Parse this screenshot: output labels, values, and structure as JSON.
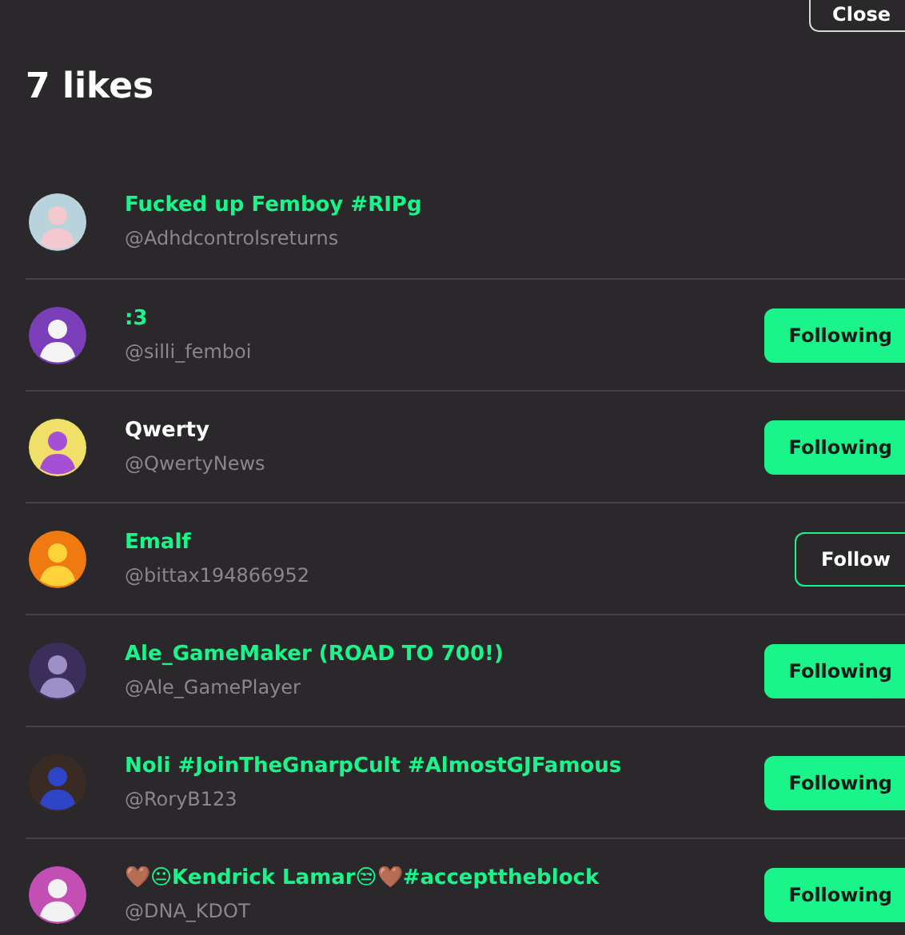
{
  "close_button": {
    "label": "Close"
  },
  "title": "7 likes",
  "users": [
    {
      "name": "Fucked up Femboy #RIPg",
      "handle": "@Adhdcontrolsreturns",
      "color": "#19f58a"
    },
    {
      "name": ":3",
      "handle": "@silli_femboi",
      "color": "#19f58a",
      "button": {
        "kind": "following",
        "label": "Following"
      }
    },
    {
      "name": "Qwerty",
      "handle": "@QwertyNews",
      "color": "#ffffff",
      "button": {
        "kind": "following",
        "label": "Following"
      }
    },
    {
      "name": "Emalf",
      "handle": "@bittax194866952",
      "color": "#19f58a",
      "button": {
        "kind": "follow",
        "label": "Follow"
      }
    },
    {
      "name": "Ale_GameMaker (ROAD TO 700!)",
      "handle": "@Ale_GamePlayer",
      "color": "#19f58a",
      "button": {
        "kind": "following",
        "label": "Following"
      }
    },
    {
      "name": "Noli #JoinTheGnarpCult #AlmostGJFamous",
      "handle": "@RoryB123",
      "color": "#19f58a",
      "button": {
        "kind": "following",
        "label": "Following"
      }
    },
    {
      "name": "🤎😐Kendrick Lamar😒🤎#accepttheblock",
      "handle": "@DNA_KDOT",
      "color": "#19f58a",
      "button": {
        "kind": "following",
        "label": "Following"
      }
    }
  ]
}
